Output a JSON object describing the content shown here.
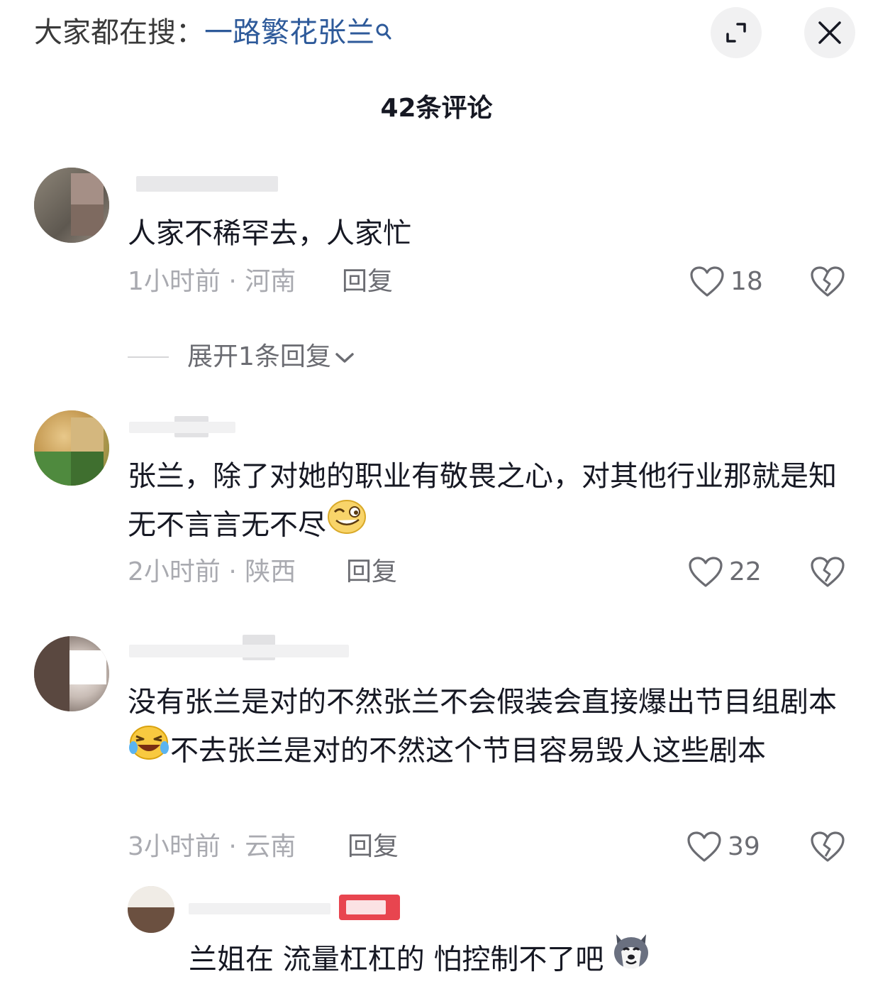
{
  "topbar": {
    "search_prefix": "大家都在搜：",
    "search_term": "一路繁花张兰",
    "expand_icon": "expand-icon",
    "close_icon": "close-icon"
  },
  "comment_count": "42条评论",
  "comments": [
    {
      "text": "人家不稀罕去，人家忙",
      "time": "1小时前",
      "location": "河南",
      "reply_label": "回复",
      "likes": "18",
      "expand_label": "展开1条回复"
    },
    {
      "text": "张兰，除了对她的职业有敬畏之心，对其他行业那就是知无不言言无不尽",
      "time": "2小时前",
      "location": "陕西",
      "reply_label": "回复",
      "likes": "22",
      "emoji": "smirk-emoji"
    },
    {
      "text_part1": "没有张兰是对的不然张兰不会假装会直接爆出节目组剧本",
      "text_part2": "不去张兰是对的不然这个节目容易毁人这些剧本",
      "time": "3小时前",
      "location": "云南",
      "reply_label": "回复",
      "likes": "39",
      "emoji": "laughing-tears-emoji"
    }
  ],
  "sub_comment": {
    "text": "兰姐在 流量杠杠的 怕控制不了吧",
    "emoji": "husky-dog-emoji"
  },
  "colors": {
    "text": "#161823",
    "meta": "#a9aab0",
    "link": "#2e5a9a",
    "action": "#6b6c72"
  }
}
